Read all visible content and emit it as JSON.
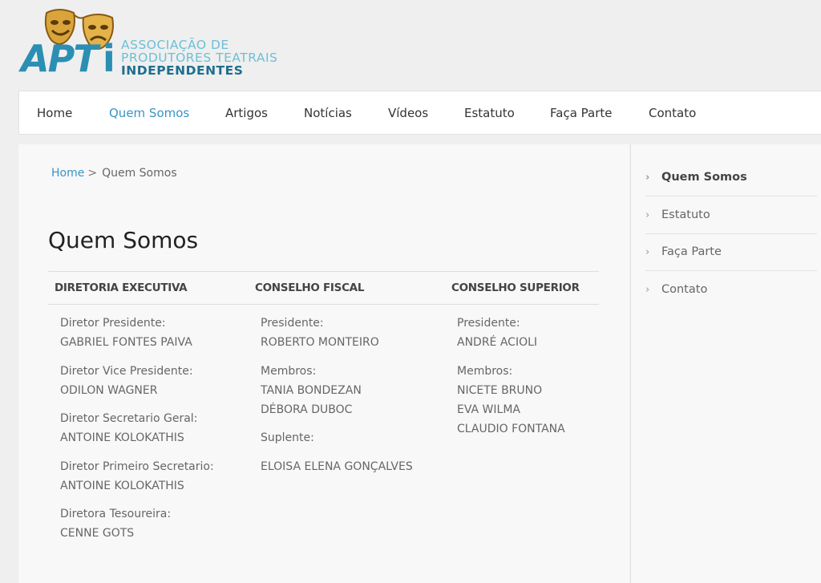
{
  "logo": {
    "abbr": "APT",
    "abbr_i": "i",
    "line1": "ASSOCIAÇÃO DE",
    "line2": "PRODUTORES TEATRAIS",
    "line3": "INDEPENDENTES",
    "icon": "theater-masks-icon"
  },
  "nav": {
    "items": [
      {
        "label": "Home"
      },
      {
        "label": "Quem Somos"
      },
      {
        "label": "Artigos"
      },
      {
        "label": "Notícias"
      },
      {
        "label": "Vídeos"
      },
      {
        "label": "Estatuto"
      },
      {
        "label": "Faça Parte"
      },
      {
        "label": "Contato"
      }
    ],
    "active_index": 1
  },
  "breadcrumb": {
    "home": "Home",
    "separator": ">",
    "current": "Quem Somos"
  },
  "page": {
    "title": "Quem Somos"
  },
  "board": {
    "headers": [
      "DIRETORIA EXECUTIVA",
      "CONSELHO FISCAL",
      "CONSELHO SUPERIOR"
    ],
    "executiva": [
      "Diretor Presidente:",
      "GABRIEL FONTES PAIVA",
      "Diretor Vice Presidente:",
      "ODILON WAGNER",
      "Diretor Secretario Geral:",
      "ANTOINE KOLOKATHIS",
      "Diretor Primeiro Secretario:",
      "ANTOINE KOLOKATHIS",
      "Diretora Tesoureira:",
      "CENNE GOTS"
    ],
    "fiscal": [
      "Presidente:",
      "ROBERTO MONTEIRO",
      "Membros:",
      "TANIA BONDEZAN",
      "DÉBORA DUBOC",
      "Suplente:",
      "ELOISA ELENA GONÇALVES"
    ],
    "superior": [
      "Presidente:",
      "ANDRÉ ACIOLI",
      "Membros:",
      "NICETE BRUNO",
      "EVA WILMA",
      "CLAUDIO FONTANA"
    ]
  },
  "sidebar": {
    "items": [
      {
        "label": "Quem Somos"
      },
      {
        "label": "Estatuto"
      },
      {
        "label": "Faça Parte"
      },
      {
        "label": "Contato"
      }
    ],
    "chevron": "›"
  },
  "colors": {
    "accent": "#3a94c4",
    "logo_blue": "#2b8fb3",
    "logo_light": "#6cc0d6",
    "logo_dark": "#1e6f8f"
  }
}
